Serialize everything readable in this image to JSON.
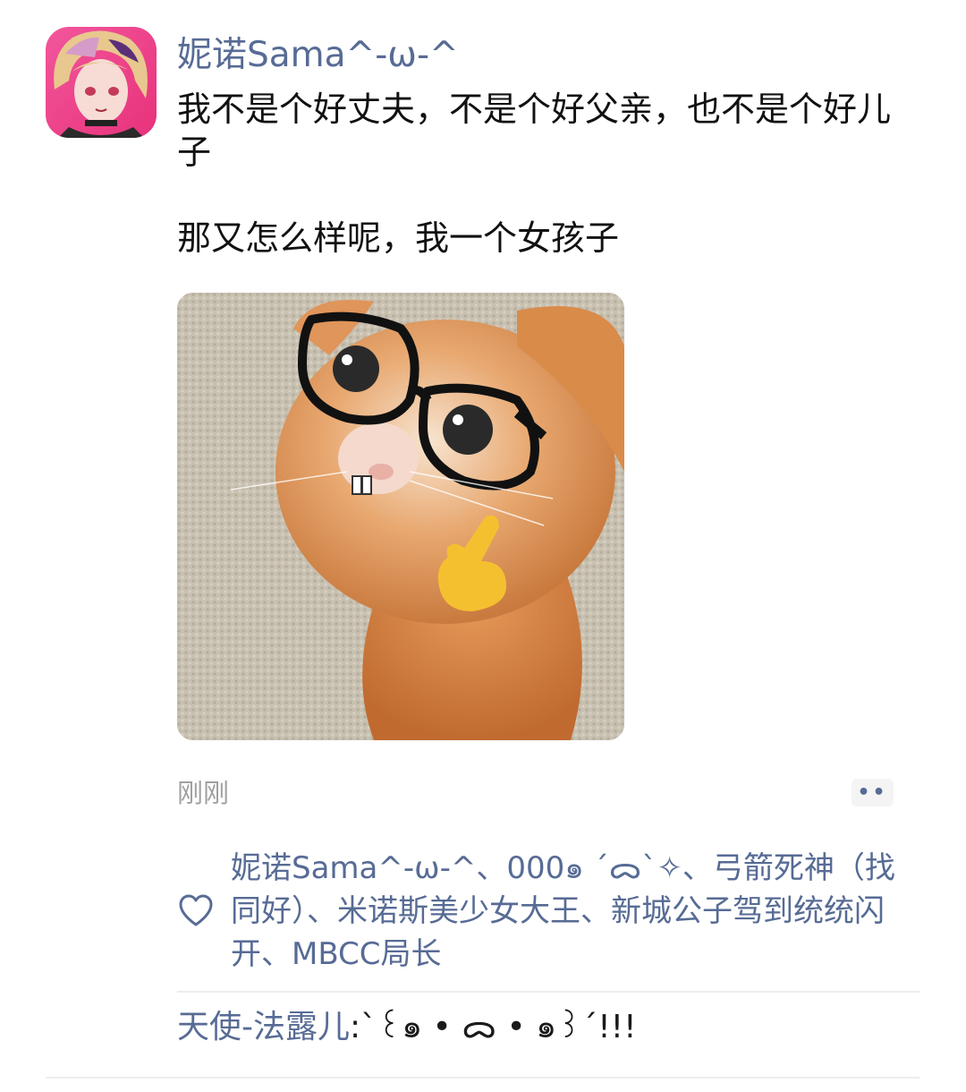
{
  "post": {
    "author": "妮诺Sama^-ω-^",
    "text_line1": "我不是个好丈夫，不是个好父亲，也不是个好儿子",
    "text_line2": "那又怎么样呢，我一个女孩子",
    "timestamp": "刚刚",
    "more_icon": "more-dots-icon"
  },
  "likes": {
    "icon": "heart-outline-icon",
    "names": "妮诺Sama^-ω-^、000๑ ˊᯅˋ✧、弓箭死神（找同好）、米诺斯美少女大王、新城公子驾到统统闪开、MBCC局长"
  },
  "comments": [
    {
      "author": "天使-法露儿",
      "separator": ":",
      "text": "ˋ꒰๑ • ᯅ • ๑꒱ˊ!!!"
    }
  ],
  "colors": {
    "link": "#576b95",
    "text": "#111111",
    "muted": "#a0a0a0",
    "divider": "#ededed"
  }
}
